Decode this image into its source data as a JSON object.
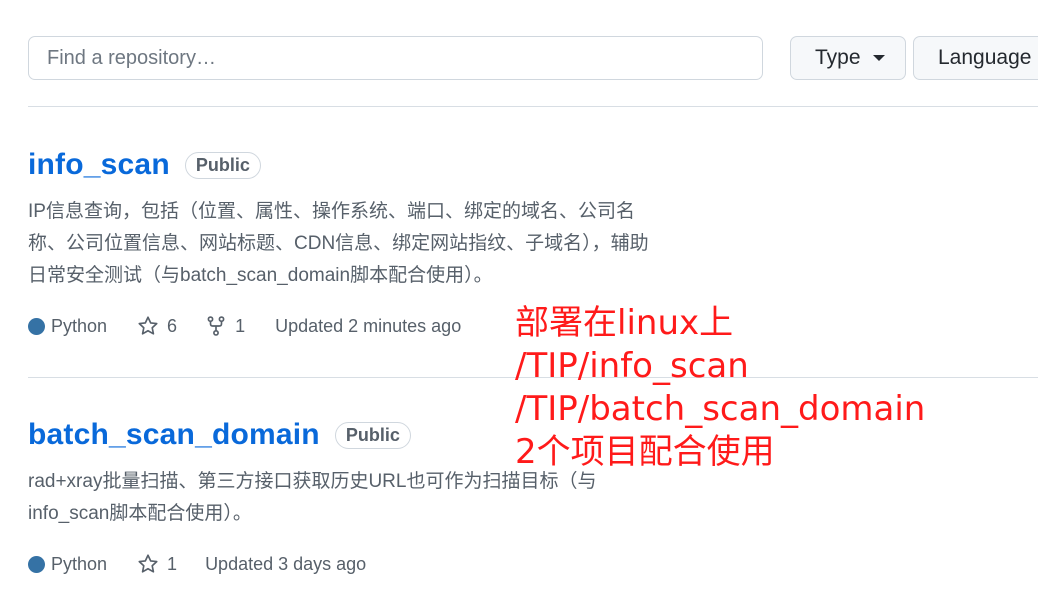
{
  "search": {
    "placeholder": "Find a repository…"
  },
  "filters": {
    "type_label": "Type",
    "language_label": "Language"
  },
  "repos": [
    {
      "name": "info_scan",
      "visibility": "Public",
      "description_lines": [
        "IP信息查询，包括（位置、属性、操作系统、端口、绑定的域名、公司名",
        "称、公司位置信息、网站标题、CDN信息、绑定网站指纹、子域名），辅助",
        "日常安全测试（与batch_scan_domain脚本配合使用）。"
      ],
      "language": "Python",
      "language_color": "#3572A5",
      "stars": "6",
      "forks": "1",
      "updated": "Updated 2 minutes ago"
    },
    {
      "name": "batch_scan_domain",
      "visibility": "Public",
      "description_lines": [
        "rad+xray批量扫描、第三方接口获取历史URL也可作为扫描目标（与",
        "info_scan脚本配合使用）。"
      ],
      "language": "Python",
      "language_color": "#3572A5",
      "stars": "1",
      "updated": "Updated 3 days ago"
    }
  ],
  "annotation": {
    "color": "#ff1a1a",
    "lines": [
      "部署在linux上",
      "/TIP/info_scan",
      "/TIP/batch_scan_domain",
      "2个项目配合使用"
    ]
  }
}
